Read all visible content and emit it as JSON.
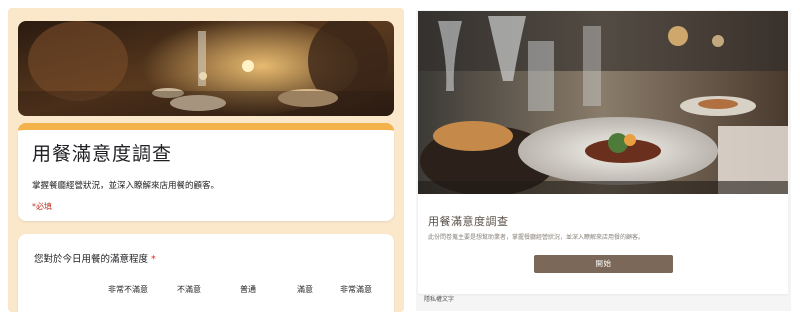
{
  "left_form": {
    "title": "用餐滿意度調查",
    "description": "掌握餐廳經營狀況，並深入瞭解來店用餐的顧客。",
    "required_note": "*必填",
    "question": {
      "label": "您對於今日用餐的滿意程度",
      "required_mark": "*",
      "options": [
        "非常不滿意",
        "不滿意",
        "普通",
        "滿意",
        "非常滿意"
      ]
    }
  },
  "right_form": {
    "title": "用餐滿意度調查",
    "description": "此份問卷蒐主要是想幫助業者，掌握餐廳經營狀況，並深入瞭解來店用餐的顧客。",
    "start_button": "開始",
    "privacy_link": "隱私權文字"
  },
  "colors": {
    "left_background": "#fbe7ca",
    "accent_bar": "#f4b24b",
    "start_button": "#7b6858"
  }
}
